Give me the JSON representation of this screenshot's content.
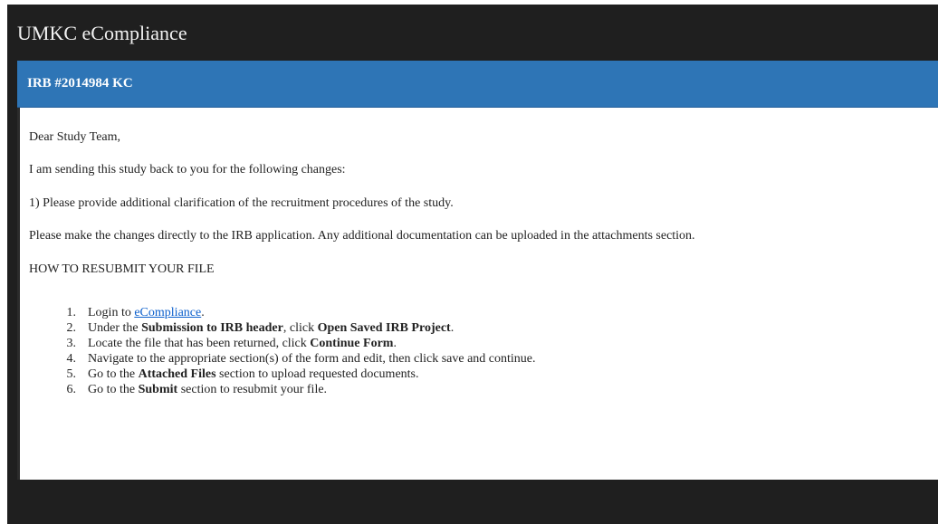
{
  "app": {
    "title": "UMKC eCompliance"
  },
  "message": {
    "header_title": "IRB #2014984 KC",
    "greeting": "Dear Study Team,",
    "intro": "I am sending this study back to you for the following changes:",
    "change_item": "1) Please provide additional clarification of the recruitment procedures of the study.",
    "instruction": "Please make the changes directly to the IRB application.  Any additional documentation can be uploaded in the attachments section.",
    "resubmit_heading": "HOW TO RESUBMIT YOUR FILE",
    "steps": [
      {
        "num": "1.",
        "before": "Login to ",
        "link": "eCompliance",
        "after": "."
      },
      {
        "num": "2.",
        "before": "Under the ",
        "bold1": "Submission to IRB header",
        "middle": ", click ",
        "bold2": "Open Saved IRB Project",
        "after": "."
      },
      {
        "num": "3.",
        "before": "Locate the file that has been returned, click ",
        "bold": "Continue Form",
        "after": "."
      },
      {
        "num": "4.",
        "text": "Navigate to the appropriate section(s) of the form and edit, then click save and continue."
      },
      {
        "num": "5.",
        "before": "Go to the ",
        "bold": "Attached Files",
        "after": " section to upload requested documents."
      },
      {
        "num": "6.",
        "before": "Go to the ",
        "bold": "Submit",
        "after": " section to resubmit your file."
      }
    ]
  },
  "colors": {
    "frame_bg": "#1f1f1f",
    "header_blue": "#2e75b6",
    "link": "#0b5fcc"
  }
}
